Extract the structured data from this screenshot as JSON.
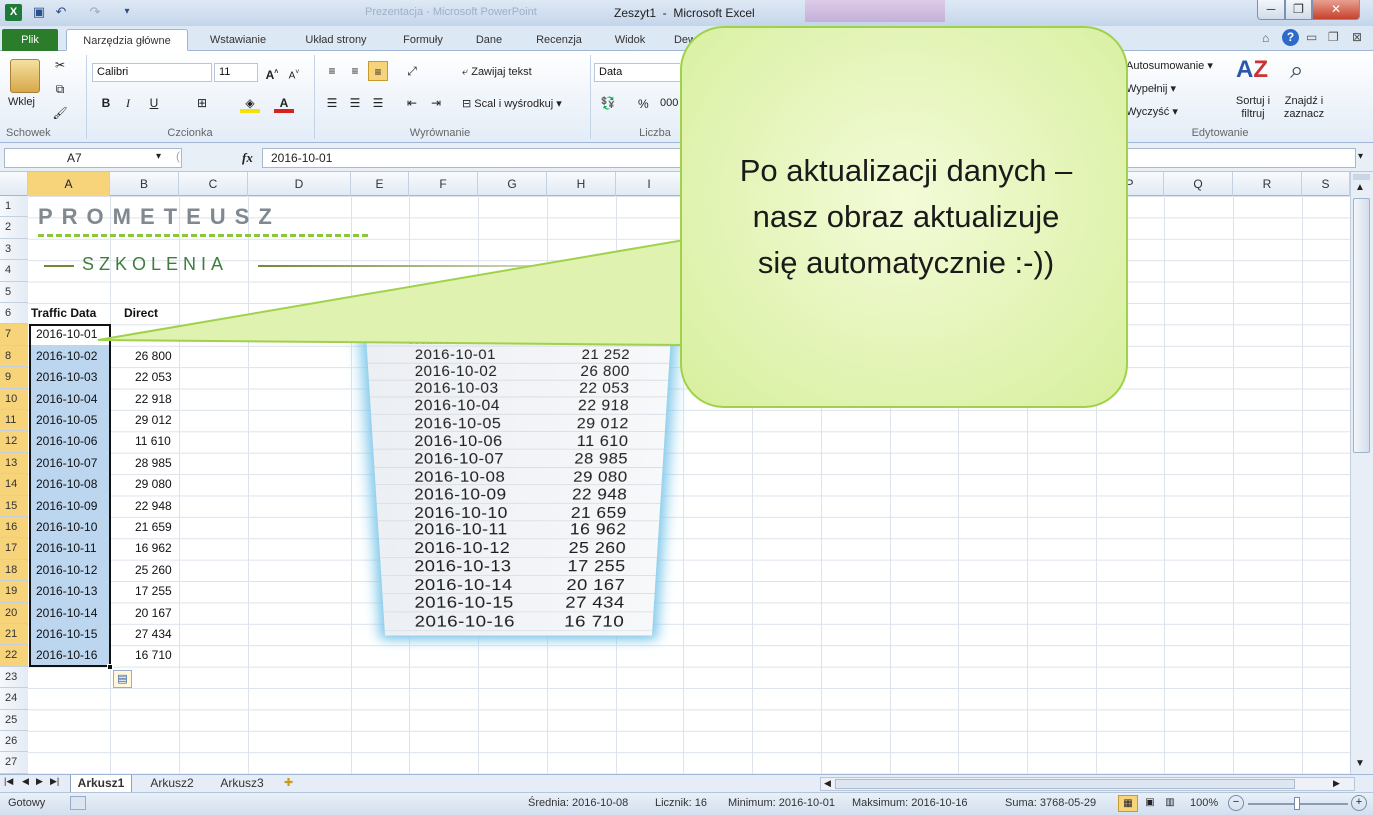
{
  "window": {
    "title": "Zeszyt1  -  Microsoft Excel",
    "faded_title": "Prezentacja - Microsoft PowerPoint"
  },
  "tabs": [
    "Plik",
    "Narzędzia główne",
    "Wstawianie",
    "Układ strony",
    "Formuły",
    "Dane",
    "Recenzja",
    "Widok",
    "Dew"
  ],
  "ribbon": {
    "clipboard": {
      "paste": "Wklej",
      "group": "Schowek"
    },
    "font": {
      "name": "Calibri",
      "size": "11",
      "bold": "B",
      "italic": "I",
      "underline": "U",
      "group": "Czcionka"
    },
    "alignment": {
      "wrap": "Zawijaj tekst",
      "merge": "Scal i wyśrodkuj",
      "group": "Wyrównanie"
    },
    "number": {
      "format": "Data",
      "percent": "%",
      "thousands": "000",
      "group": "Liczba"
    },
    "editing": {
      "autosum": "Autosumowanie",
      "fill": "Wypełnij",
      "clear": "Wyczyść",
      "sort": "Sortuj i filtruj",
      "find": "Znajdź i zaznacz",
      "group": "Edytowanie"
    }
  },
  "formula_bar": {
    "name_box": "A7",
    "fx": "fx",
    "value": "2016-10-01"
  },
  "columns": [
    "A",
    "B",
    "C",
    "D",
    "E",
    "F",
    "G",
    "H",
    "I",
    "P",
    "Q",
    "R",
    "S"
  ],
  "rows": [
    "1",
    "2",
    "3",
    "4",
    "5",
    "6",
    "7",
    "8",
    "9",
    "10",
    "11",
    "12",
    "13",
    "14",
    "15",
    "16",
    "17",
    "18",
    "19",
    "20",
    "21",
    "22",
    "23",
    "24",
    "25",
    "26",
    "27"
  ],
  "logo": {
    "name": "PROMETEUSZ",
    "tagline": "SZKOLENIA"
  },
  "table": {
    "headers": [
      "Traffic Data",
      "Direct"
    ],
    "rows": [
      [
        "2016-10-01",
        "21 252"
      ],
      [
        "2016-10-02",
        "26 800"
      ],
      [
        "2016-10-03",
        "22 053"
      ],
      [
        "2016-10-04",
        "22 918"
      ],
      [
        "2016-10-05",
        "29 012"
      ],
      [
        "2016-10-06",
        "11 610"
      ],
      [
        "2016-10-07",
        "28 985"
      ],
      [
        "2016-10-08",
        "29 080"
      ],
      [
        "2016-10-09",
        "22 948"
      ],
      [
        "2016-10-10",
        "21 659"
      ],
      [
        "2016-10-11",
        "16 962"
      ],
      [
        "2016-10-12",
        "25 260"
      ],
      [
        "2016-10-13",
        "17 255"
      ],
      [
        "2016-10-14",
        "20 167"
      ],
      [
        "2016-10-15",
        "27 434"
      ],
      [
        "2016-10-16",
        "16 710"
      ]
    ]
  },
  "picture_header": [
    "Traffic Data",
    "Direct"
  ],
  "callout": {
    "lines": [
      "Po aktualizacji danych –",
      "nasz obraz aktualizuje",
      "się automatycznie :-))"
    ]
  },
  "sheets": [
    "Arkusz1",
    "Arkusz2",
    "Arkusz3"
  ],
  "status": {
    "ready": "Gotowy",
    "average": "Średnia: 2016-10-08",
    "count": "Licznik: 16",
    "min": "Minimum: 2016-10-01",
    "max": "Maksimum: 2016-10-16",
    "sum": "Suma: 3768-05-29",
    "zoom": "100%"
  },
  "colors": {
    "accent": "#2b7d2b",
    "selection": "#bcd6ef",
    "callout": "#d7ef9d"
  }
}
